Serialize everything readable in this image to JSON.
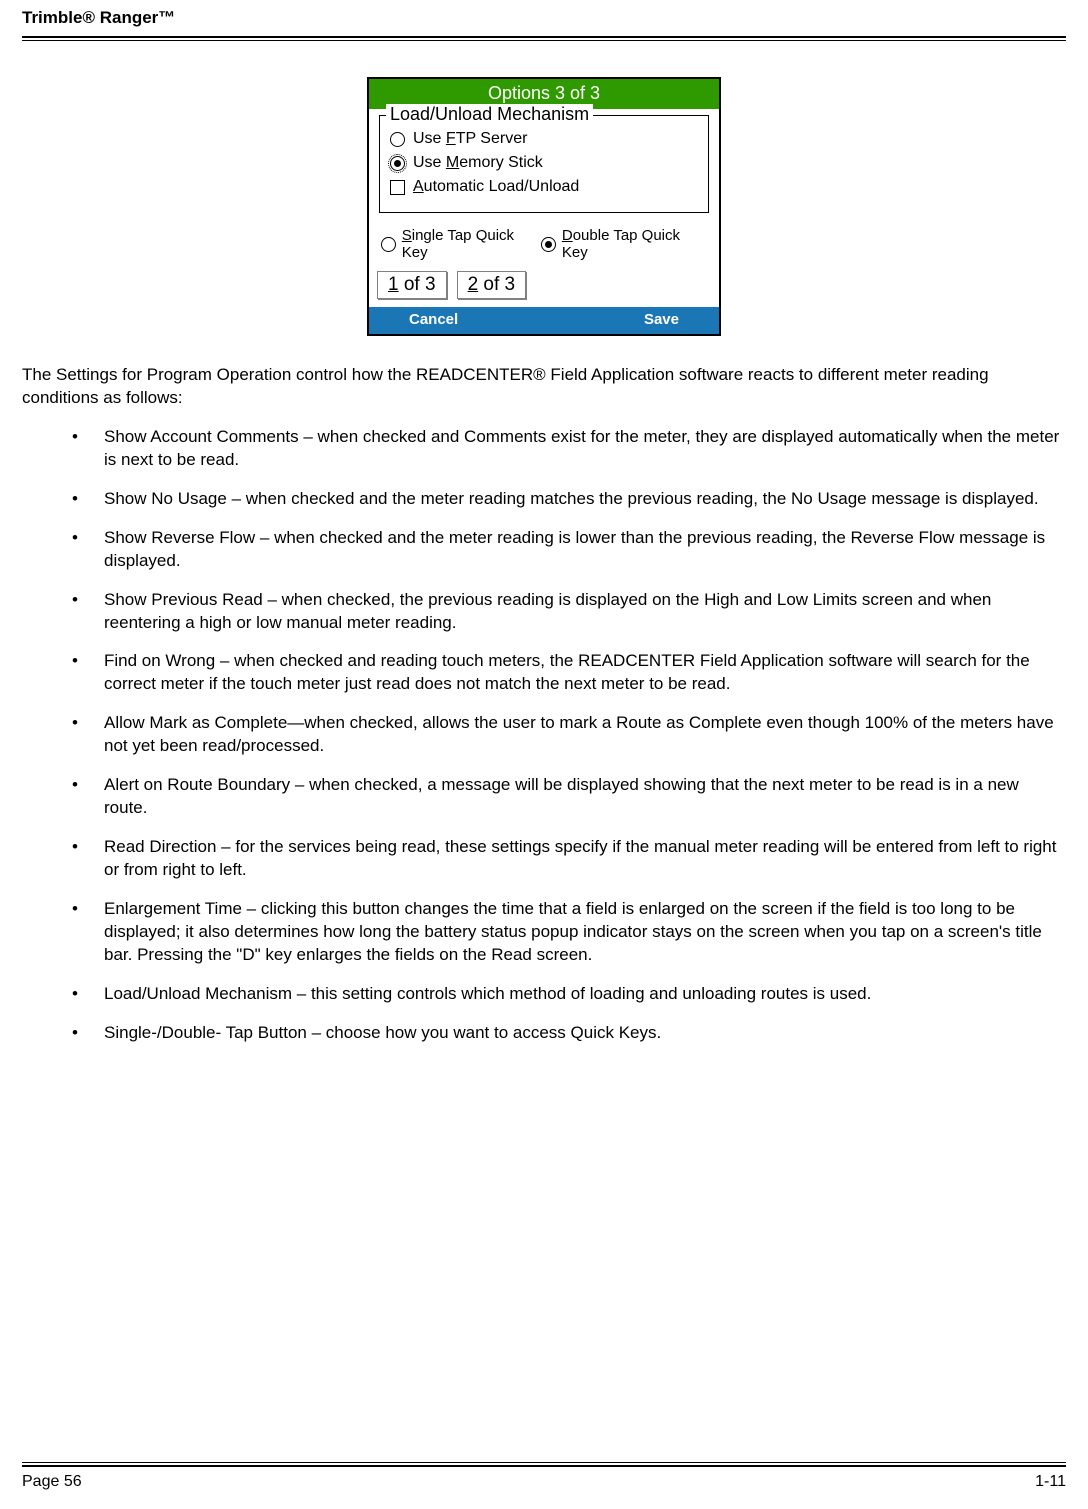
{
  "header": {
    "title": "Trimble® Ranger™"
  },
  "screenshot": {
    "title": "Options 3 of 3",
    "group_legend": "Load/Unload Mechanism",
    "opt_ftp": {
      "pre": "Use ",
      "u": "F",
      "post": "TP Server"
    },
    "opt_mem": {
      "pre": "Use ",
      "u": "M",
      "post": "emory Stick"
    },
    "opt_auto": {
      "u": "A",
      "post": "utomatic Load/Unload"
    },
    "tap_single": {
      "u": "S",
      "post": "ingle Tap Quick Key"
    },
    "tap_double": {
      "u": "D",
      "post": "ouble Tap Quick Key"
    },
    "tab1": {
      "u": "1",
      "post": " of 3"
    },
    "tab2": {
      "u": "2",
      "post": " of 3"
    },
    "cancel": "Cancel",
    "save": "Save"
  },
  "intro": "The Settings for Program Operation control how the READCENTER® Field Application software reacts to different meter reading conditions as follows:",
  "bullets": [
    "Show Account Comments – when checked and Comments exist for the meter, they are displayed automatically when the meter is next to be read.",
    "Show No Usage – when checked and the meter reading matches the previous reading, the No Usage message is displayed.",
    "Show Reverse Flow – when checked and the meter reading is lower than the previous reading, the Reverse Flow message is displayed.",
    "Show Previous Read – when checked, the previous reading is displayed on the High and Low Limits screen and when reentering a high or low manual meter reading.",
    "Find on Wrong – when checked and reading touch meters, the READCENTER Field Application software will search for the correct meter if the touch meter just read does not match the next meter to be read.",
    "Allow Mark as Complete—when checked, allows the user to mark a Route as Complete even though 100% of the meters have not yet been read/processed.",
    "Alert on Route Boundary – when checked, a message will be displayed showing that the next meter to be read is in a new route.",
    "Read Direction – for the services being read, these settings specify if the manual meter reading will be entered from left to right or from right to left.",
    "Enlargement Time – clicking this button changes the time that a field is enlarged on the screen if the field is too long to be displayed; it also determines how long the battery status popup indicator stays on the screen when you tap on a screen's title bar.  Pressing the \"D\" key enlarges the fields on the Read screen.",
    "Load/Unload Mechanism – this setting controls which method of loading and unloading routes is used.",
    "Single-/Double- Tap Button – choose how you want to access Quick Keys."
  ],
  "footer": {
    "left": "Page 56",
    "right": "1-11"
  }
}
